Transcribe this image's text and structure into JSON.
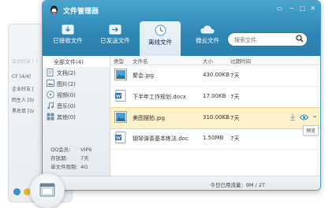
{
  "background_panel": {
    "rows": [
      {
        "label": "会员好友 ( )",
        "faded": true
      },
      {
        "label": "CF [4/4]",
        "faded": false
      },
      {
        "label": "企业好友 [",
        "faded": false
      },
      {
        "label": "陌生人 [0/",
        "faded": false
      },
      {
        "label": "黑名单 [0/",
        "faded": false
      }
    ]
  },
  "window": {
    "title": "文件管理器",
    "controls": [
      "▭",
      "−",
      "□",
      "✕"
    ],
    "tabs": [
      {
        "label": "已接收文件",
        "icon": "inbox-icon",
        "active": false
      },
      {
        "label": "已发送文件",
        "icon": "outbox-icon",
        "active": false
      },
      {
        "label": "离线文件",
        "icon": "clock-icon",
        "active": true
      },
      {
        "label": "微云文件",
        "icon": "cloud-icon",
        "active": false
      }
    ],
    "search": {
      "placeholder": "搜索文件"
    }
  },
  "sidebar": {
    "categories": [
      {
        "label": "全部文件(4)",
        "icon": "all-files-icon",
        "selected": true
      },
      {
        "label": "文档(2)",
        "icon": "document-icon",
        "selected": false
      },
      {
        "label": "图片(2)",
        "icon": "image-icon",
        "selected": false
      },
      {
        "label": "视频(0)",
        "icon": "video-icon",
        "selected": false
      },
      {
        "label": "音乐(0)",
        "icon": "music-icon",
        "selected": false
      },
      {
        "label": "其他(0)",
        "icon": "other-icon",
        "selected": false
      }
    ],
    "stats": [
      {
        "key": "QQ会员:",
        "value": "VIP6"
      },
      {
        "key": "存放期:",
        "value": "7天"
      },
      {
        "key": "单文件限制:",
        "value": "4G"
      }
    ]
  },
  "list": {
    "headers": {
      "type": "类型",
      "name": "文件名",
      "size": "大小",
      "expiry": "过期时间"
    },
    "rows": [
      {
        "name": "聚会.jpg",
        "size": "430.00KB",
        "expiry": "7天",
        "kind": "image",
        "highlighted": false
      },
      {
        "name": "下半年工作规划.docx",
        "size": "17.00KB",
        "expiry": "7天",
        "kind": "doc",
        "highlighted": false
      },
      {
        "name": "美图摆拍.jpg",
        "size": "310.00KB",
        "expiry": "7天",
        "kind": "image",
        "highlighted": true
      },
      {
        "name": "钢琴弹奏基本练法.doc",
        "size": "1.50MB",
        "expiry": "7天",
        "kind": "doc",
        "highlighted": false
      }
    ],
    "row_actions": {
      "icons": [
        "download-icon",
        "preview-icon",
        "more-icon"
      ],
      "tooltip": "预览"
    }
  },
  "statusbar": {
    "text": "今日已用流量：9M / 2T"
  },
  "colors": {
    "titlebar": "#2f86b4",
    "highlight": "#fcf1c8",
    "accent": "#2b78a0"
  }
}
